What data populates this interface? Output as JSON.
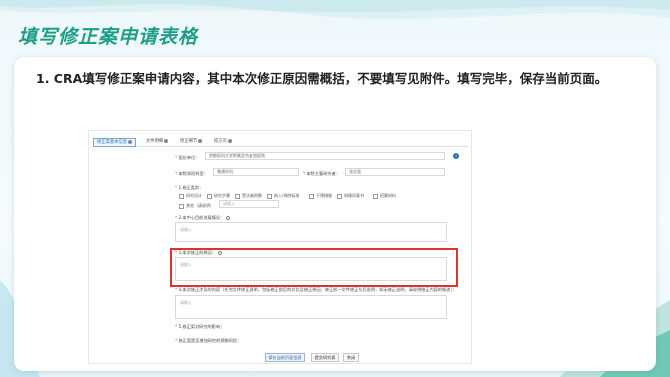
{
  "slide": {
    "title": "填写修正案申请表格",
    "instruction": "1. CRA填写修正案申请内容，其中本次修正原因需概括，不要填写见附件。填写完毕，保存当前页面。"
  },
  "form": {
    "tabs": [
      "修正案基本信息",
      "文件明细",
      "修正细节",
      "提交页"
    ],
    "org_label": "组长单位：",
    "org_value": "首都医科大学附属北京友谊医院",
    "center_label": "本院承担科室：",
    "center_value": "普通外科",
    "pi_label": "本院主要研究者：",
    "pi_value": "张志强",
    "type_label": "1.修正类别：",
    "type_options": [
      "研究设计",
      "研究步骤",
      "受试者例数",
      "纳入/排除标准",
      "干预措施",
      "知情同意书",
      "招募材料"
    ],
    "other_label": "其他（请说明）",
    "other_placeholder": "请输入",
    "q2_label": "2.本中心目前进展情况：",
    "q3_label": "3.本次修正的原因：",
    "q4_label": "4.本次修正涉及的内容（任何文件修正说明，包括修正前后的对比及修正原因，修正前一文件修正与后说明，如无修正说明，请说明修正内容的概述）：",
    "q5_label": "5.修正案对研究的影响：",
    "q6_label": "修正案是否增加研究的预期风险：",
    "textarea_placeholder": "请输入",
    "buttons": {
      "save": "保存当前页面信息",
      "submit": "提交研究表",
      "close": "关闭"
    }
  },
  "colors": {
    "title": "#1e9e86",
    "highlight": "#e0312b",
    "info": "#2f6fb8"
  }
}
